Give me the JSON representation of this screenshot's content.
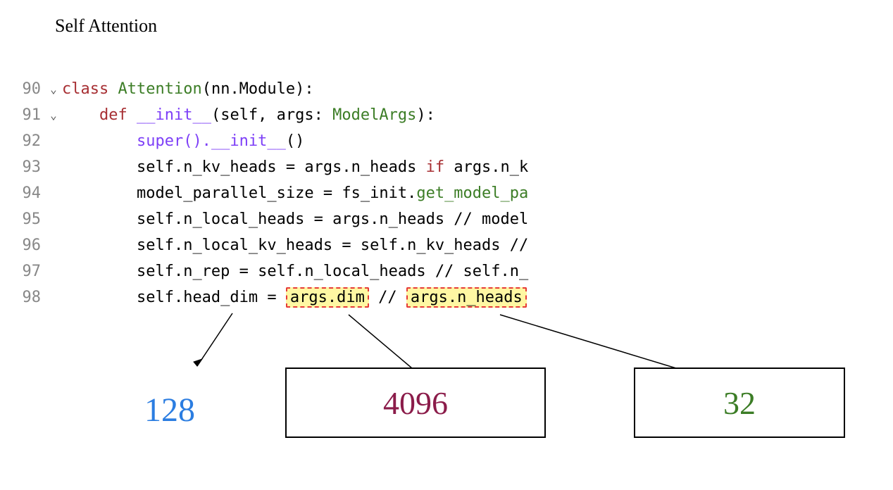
{
  "title": "Self Attention",
  "code": {
    "lines": [
      {
        "num": "90",
        "fold": true
      },
      {
        "num": "91",
        "fold": true
      },
      {
        "num": "92",
        "fold": false
      },
      {
        "num": "93",
        "fold": false
      },
      {
        "num": "94",
        "fold": false
      },
      {
        "num": "95",
        "fold": false
      },
      {
        "num": "96",
        "fold": false
      },
      {
        "num": "97",
        "fold": false
      },
      {
        "num": "98",
        "fold": false
      }
    ],
    "tokens": {
      "class_kw": "class",
      "class_name": "Attention",
      "paren_nn_module": "(nn.Module):",
      "def_kw": "def",
      "init_name": "__init__",
      "init_sig_open": "(self, args: ",
      "model_args": "ModelArgs",
      "init_sig_close": "):",
      "super_call": "super().",
      "super_init": "__init__",
      "super_close": "()",
      "l93_a": "self.n_kv_heads = args.n_heads ",
      "l93_if": "if",
      "l93_b": " args.n_k",
      "l94_a": "model_parallel_size = fs_init.",
      "l94_b": "get_model_pa",
      "l95": "self.n_local_heads = args.n_heads // model",
      "l96": "self.n_local_kv_heads = self.n_kv_heads //",
      "l97": "self.n_rep = self.n_local_heads // self.n_",
      "l98_a": "self.head_dim = ",
      "l98_h1": "args.dim",
      "l98_mid": " // ",
      "l98_h2": "args.n_heads"
    }
  },
  "annotations": {
    "head_dim_value": "128",
    "dim_value": "4096",
    "n_heads_value": "32"
  }
}
